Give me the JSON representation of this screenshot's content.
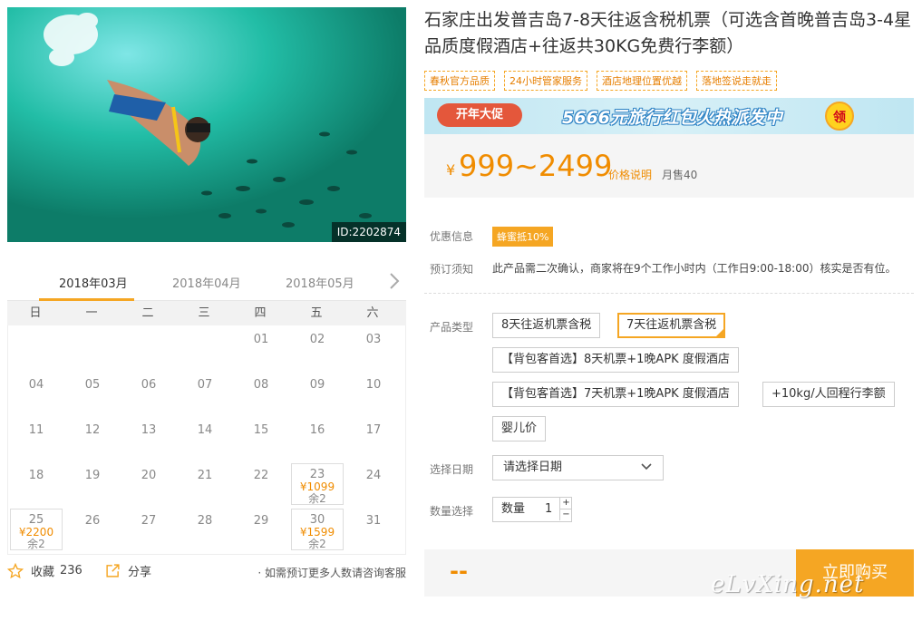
{
  "photo": {
    "id_label": "ID:2202874"
  },
  "calendar": {
    "months": [
      "2018年03月",
      "2018年04月",
      "2018年05月"
    ],
    "weekdays": [
      "日",
      "一",
      "二",
      "三",
      "四",
      "五",
      "六"
    ],
    "days": [
      {
        "d": "01"
      },
      {
        "d": "02"
      },
      {
        "d": "03"
      },
      {
        "d": "04"
      },
      {
        "d": "05"
      },
      {
        "d": "06"
      },
      {
        "d": "07"
      },
      {
        "d": "08"
      },
      {
        "d": "09"
      },
      {
        "d": "10"
      },
      {
        "d": "11"
      },
      {
        "d": "12"
      },
      {
        "d": "13"
      },
      {
        "d": "14"
      },
      {
        "d": "15"
      },
      {
        "d": "16"
      },
      {
        "d": "17"
      },
      {
        "d": "18"
      },
      {
        "d": "19"
      },
      {
        "d": "20"
      },
      {
        "d": "21"
      },
      {
        "d": "22"
      },
      {
        "d": "23",
        "price": "¥1099",
        "remain": "余2"
      },
      {
        "d": "24"
      },
      {
        "d": "25",
        "price": "¥2200",
        "remain": "余2"
      },
      {
        "d": "26"
      },
      {
        "d": "27"
      },
      {
        "d": "28"
      },
      {
        "d": "29"
      },
      {
        "d": "30",
        "price": "¥1599",
        "remain": "余2"
      },
      {
        "d": "31"
      }
    ]
  },
  "footer": {
    "favorite_label": "收藏",
    "favorite_count": "236",
    "share_label": "分享",
    "note": "· 如需预订更多人数请咨询客服"
  },
  "product": {
    "title": "石家庄出发普吉岛7-8天往返含税机票（可选含首晚普吉岛3-4星品质度假酒店+往返共30KG免费行李额）",
    "tags": [
      "春秋官方品质",
      "24小时管家服务",
      "酒店地理位置优越",
      "落地签说走就走"
    ]
  },
  "banner": {
    "badge": "开年大促",
    "text": "5666元旅行红包火热派发中",
    "coin": "领"
  },
  "price": {
    "currency": "¥",
    "range": "999~2499",
    "note": "价格说明",
    "sold": "月售40"
  },
  "info": {
    "promo_label": "优惠信息",
    "promo_badge": "蜂蜜抵10%",
    "notice_label": "预订须知",
    "notice_text": "此产品需二次确认，商家将在9个工作小时内（工作日9:00-18:00）核实是否有位。"
  },
  "options": {
    "label": "产品类型",
    "items": [
      "8天往返机票含税",
      "7天往返机票含税",
      "【背包客首选】8天机票+1晚APK 度假酒店",
      "【背包客首选】7天机票+1晚APK 度假酒店",
      "+10kg/人回程行李额",
      "婴儿价"
    ],
    "selected": "7天往返机票含税"
  },
  "date": {
    "label": "选择日期",
    "placeholder": "请选择日期"
  },
  "quantity": {
    "label": "数量选择",
    "field_label": "数量",
    "value": "1",
    "plus": "+",
    "minus": "−"
  },
  "buy": {
    "total": "--",
    "button": "立即购买"
  },
  "watermark": "eLvXing.net",
  "colors": {
    "accent": "#f5a623",
    "price": "#f08c00"
  }
}
